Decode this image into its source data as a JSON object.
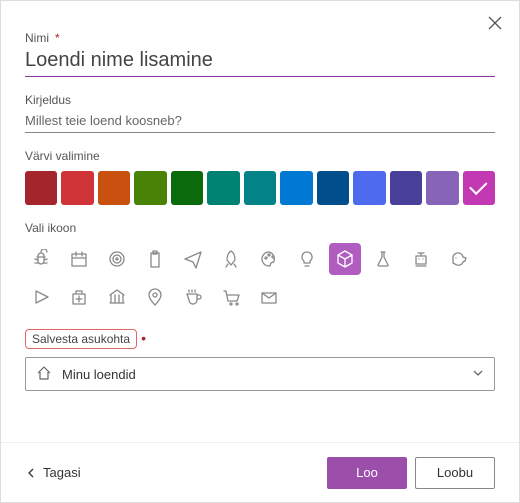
{
  "labels": {
    "name": "Nimi",
    "description": "Kirjeldus",
    "chooseColor": "Värvi valimine",
    "chooseIcon": "Vali ikoon",
    "saveLocation": "Salvesta asukohta",
    "back": "Tagasi",
    "create": "Loo",
    "cancel": "Loobu"
  },
  "placeholders": {
    "name": "Loendi nime lisamine",
    "description": "Millest teie loend koosneb?"
  },
  "values": {
    "name": "",
    "description": ""
  },
  "colors": [
    {
      "hex": "#a4262c",
      "name": "dark-red",
      "selected": false
    },
    {
      "hex": "#d13438",
      "name": "red",
      "selected": false
    },
    {
      "hex": "#ca5010",
      "name": "orange",
      "selected": false
    },
    {
      "hex": "#498205",
      "name": "olive",
      "selected": false
    },
    {
      "hex": "#0b6a0b",
      "name": "green",
      "selected": false
    },
    {
      "hex": "#008272",
      "name": "teal",
      "selected": false
    },
    {
      "hex": "#038387",
      "name": "cyan",
      "selected": false
    },
    {
      "hex": "#0078d4",
      "name": "blue",
      "selected": false
    },
    {
      "hex": "#004e8c",
      "name": "dark-blue",
      "selected": false
    },
    {
      "hex": "#4f6bed",
      "name": "indigo",
      "selected": false
    },
    {
      "hex": "#49409a",
      "name": "violet",
      "selected": false
    },
    {
      "hex": "#8764b8",
      "name": "purple",
      "selected": false
    },
    {
      "hex": "#c239b3",
      "name": "magenta",
      "selected": true
    }
  ],
  "icons": [
    {
      "name": "bug",
      "selected": false
    },
    {
      "name": "calendar",
      "selected": false
    },
    {
      "name": "target",
      "selected": false
    },
    {
      "name": "clipboard",
      "selected": false
    },
    {
      "name": "airplane",
      "selected": false
    },
    {
      "name": "rocket",
      "selected": false
    },
    {
      "name": "palette",
      "selected": false
    },
    {
      "name": "lightbulb",
      "selected": false
    },
    {
      "name": "cube",
      "selected": true
    },
    {
      "name": "flask",
      "selected": false
    },
    {
      "name": "robot",
      "selected": false
    },
    {
      "name": "piggybank",
      "selected": false
    },
    {
      "name": "play",
      "selected": false
    },
    {
      "name": "firstaid",
      "selected": false
    },
    {
      "name": "bank",
      "selected": false
    },
    {
      "name": "location",
      "selected": false
    },
    {
      "name": "coffee",
      "selected": false
    },
    {
      "name": "cart",
      "selected": false
    },
    {
      "name": "mail",
      "selected": false
    }
  ],
  "location": {
    "selected": "Minu loendid"
  }
}
